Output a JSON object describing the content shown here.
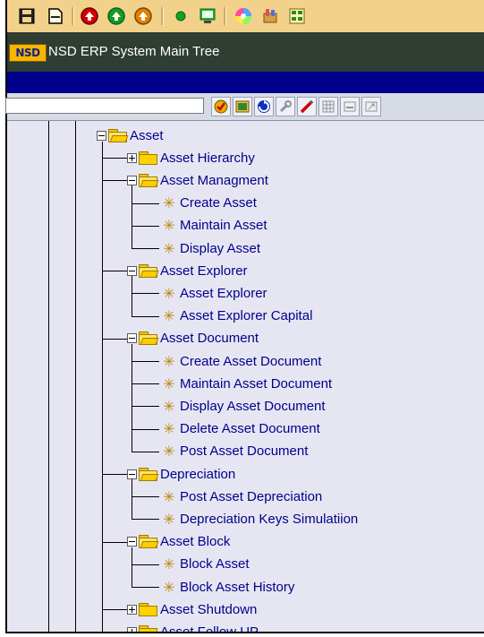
{
  "title": "NSD ERP System Main Tree",
  "logo_text": "NSD",
  "search": {
    "value": "",
    "placeholder": ""
  },
  "tree": {
    "root": "Asset",
    "items": [
      {
        "label": "Asset Hierarchy",
        "type": "folder",
        "state": "collapsed"
      },
      {
        "label": "Asset Managment",
        "type": "folder",
        "state": "expanded"
      },
      {
        "label": "Create Asset",
        "type": "transaction"
      },
      {
        "label": "Maintain Asset",
        "type": "transaction"
      },
      {
        "label": "Display Asset",
        "type": "transaction"
      },
      {
        "label": "Asset Explorer",
        "type": "folder",
        "state": "expanded"
      },
      {
        "label": "Asset Explorer",
        "type": "transaction"
      },
      {
        "label": "Asset Explorer Capital",
        "type": "transaction"
      },
      {
        "label": "Asset Document",
        "type": "folder",
        "state": "expanded"
      },
      {
        "label": "Create Asset Document",
        "type": "transaction"
      },
      {
        "label": "Maintain Asset Document",
        "type": "transaction"
      },
      {
        "label": "Display Asset Document",
        "type": "transaction"
      },
      {
        "label": "Delete Asset Document",
        "type": "transaction"
      },
      {
        "label": "Post Asset Document",
        "type": "transaction"
      },
      {
        "label": "Depreciation",
        "type": "folder",
        "state": "expanded"
      },
      {
        "label": "Post Asset Depreciation",
        "type": "transaction"
      },
      {
        "label": "Depreciation Keys Simulatiion",
        "type": "transaction"
      },
      {
        "label": "Asset Block",
        "type": "folder",
        "state": "expanded"
      },
      {
        "label": "Block Asset",
        "type": "transaction"
      },
      {
        "label": "Block Asset History",
        "type": "transaction"
      },
      {
        "label": "Asset Shutdown",
        "type": "folder",
        "state": "collapsed"
      },
      {
        "label": "Asset Follow UP",
        "type": "folder",
        "state": "collapsed"
      }
    ]
  },
  "colors": {
    "toolbar": "#f2d28a",
    "titlebar": "#2f3d33",
    "accent_bar": "#00008c",
    "tree_bg": "#e6e6f2",
    "tree_text": "#00008c"
  },
  "icons": {
    "toolbar": [
      "save-icon",
      "new-document-icon",
      "back-icon",
      "exit-icon",
      "cancel-icon",
      "status-light-icon",
      "display-icon",
      "color-wheel-icon",
      "tools-icon",
      "layout-icon"
    ],
    "tree_toolbar": [
      "check-icon",
      "image-icon",
      "refresh-icon",
      "wrench-icon",
      "pencil-icon",
      "grid-icon",
      "minimize-icon",
      "export-icon"
    ]
  }
}
